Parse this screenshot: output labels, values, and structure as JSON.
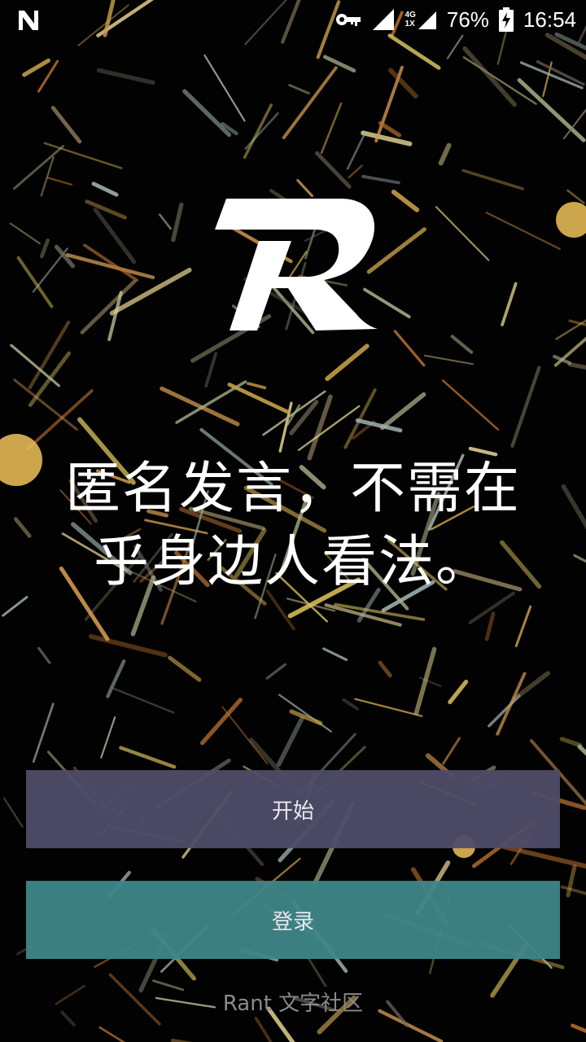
{
  "status_bar": {
    "network_4g": "4G",
    "network_1x": "1X",
    "battery": "76%",
    "time": "16:54",
    "icons": [
      "notification-n-icon",
      "vpn-key-icon",
      "signal-icon",
      "mobile-data-icon",
      "battery-charging-icon"
    ]
  },
  "logo": {
    "icon": "r-logo-icon"
  },
  "headline": {
    "line1": "匿名发言，不需在",
    "line2": "乎身边人看法。"
  },
  "buttons": {
    "start_label": "开始",
    "login_label": "登录"
  },
  "footer": {
    "text": "Rant 文字社区"
  },
  "colors": {
    "background": "#020202",
    "start_button": "#4e4c68",
    "login_button": "#3e8688",
    "footer_text": "#8a8a8a"
  }
}
